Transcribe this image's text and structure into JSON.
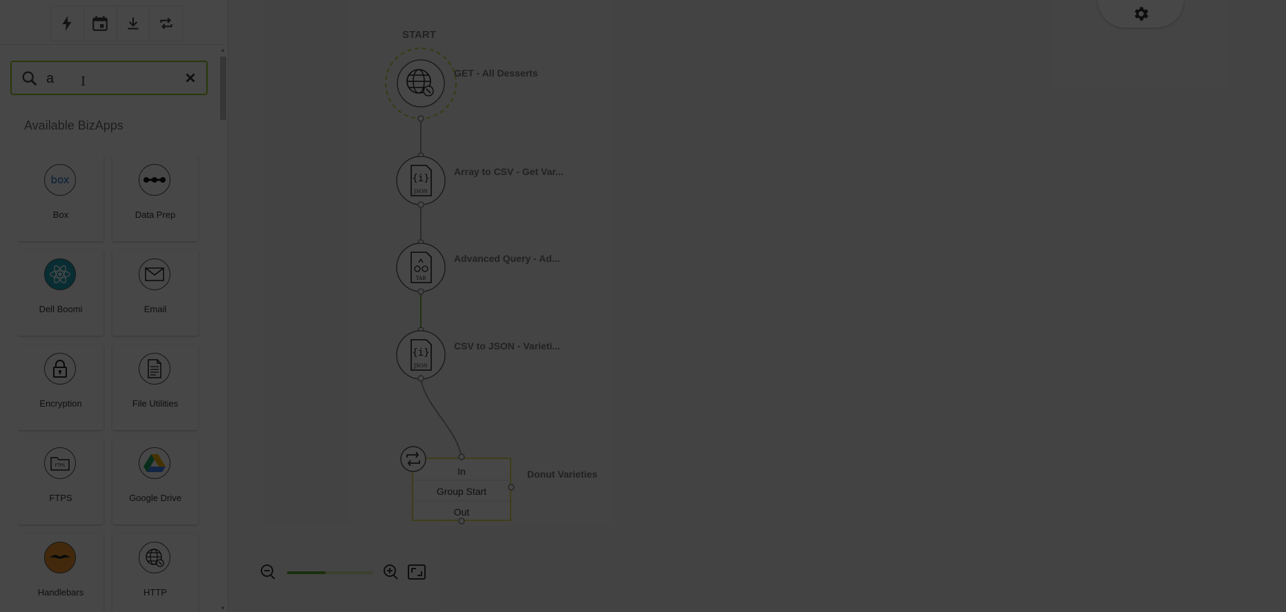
{
  "toolbar": {
    "buttons": [
      {
        "name": "trigger",
        "icon": "lightning-icon"
      },
      {
        "name": "schedule",
        "icon": "calendar-icon"
      },
      {
        "name": "import",
        "icon": "download-icon"
      },
      {
        "name": "loop",
        "icon": "repeat-icon"
      }
    ]
  },
  "search": {
    "value": "a",
    "placeholder": ""
  },
  "sidebar": {
    "section_title": "Available BizApps",
    "apps": [
      {
        "label": "Box",
        "icon": "box-icon"
      },
      {
        "label": "Data Prep",
        "icon": "data-prep-icon"
      },
      {
        "label": "Dell Boomi",
        "icon": "dell-boomi-icon"
      },
      {
        "label": "Email",
        "icon": "email-icon"
      },
      {
        "label": "Encryption",
        "icon": "lock-icon"
      },
      {
        "label": "File Utilities",
        "icon": "file-icon"
      },
      {
        "label": "FTPS",
        "icon": "ftps-folder-icon"
      },
      {
        "label": "Google Drive",
        "icon": "google-drive-icon"
      },
      {
        "label": "Handlebars",
        "icon": "handlebars-icon"
      },
      {
        "label": "HTTP",
        "icon": "http-globe-icon"
      }
    ],
    "box_logo_text": "box",
    "ftps_text": "FTPS"
  },
  "flow": {
    "start_label": "START",
    "nodes": [
      {
        "label": "GET - All Desserts",
        "icon": "globe-icon"
      },
      {
        "label": "Array to CSV - Get Var...",
        "icon": "json-file-icon"
      },
      {
        "label": "Advanced Query - Ad...",
        "icon": "tab-file-icon"
      },
      {
        "label": "CSV to JSON - Varieti...",
        "icon": "json-file-icon"
      }
    ],
    "json_badge": "JSON",
    "tab_badge": "TAB",
    "group": {
      "label": "Donut Varieties",
      "rows": [
        "In",
        "Group Start",
        "Out"
      ]
    }
  },
  "zoom": {
    "level": 0.45
  },
  "colors": {
    "accent_green": "#8fc41f",
    "group_border": "#e3dc5a",
    "overlay": "rgba(0,0,0,0.72)"
  }
}
